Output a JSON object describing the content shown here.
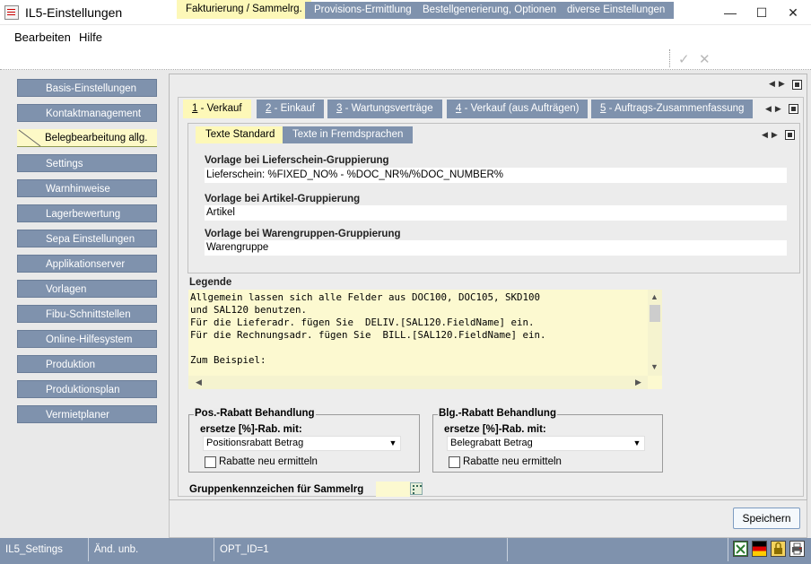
{
  "window": {
    "title": "IL5-Einstellungen",
    "minimize": "—",
    "maximize": "☐",
    "close": "✕"
  },
  "menu": {
    "items": [
      "Bearbeiten",
      "Hilfe"
    ]
  },
  "toolbar": {
    "ok_icon": "✓",
    "cancel_icon": "✕"
  },
  "sidebar": {
    "items": [
      "Basis-Einstellungen",
      "Kontaktmanagement",
      "Belegbearbeitung allg.",
      "Settings",
      "Warnhinweise",
      "Lagerbewertung",
      "Sepa Einstellungen",
      "Applikationserver",
      "Vorlagen",
      "Fibu-Schnittstellen",
      "Online-Hilfesystem",
      "Produktion",
      "Produktionsplan",
      "Vermietplaner"
    ],
    "active_index": 2
  },
  "tabs_main": [
    "Fakturierung / Sammelrg.",
    "Provisions-Ermittlung",
    "Bestellgenerierung, Optionen",
    "diverse Einstellungen"
  ],
  "tabs_sub": [
    {
      "num": "1",
      "label": " - Verkauf"
    },
    {
      "num": "2",
      "label": " - Einkauf"
    },
    {
      "num": "3",
      "label": " - Wartungsverträge"
    },
    {
      "num": "4",
      "label": " - Verkauf (aus Aufträgen)"
    },
    {
      "num": "5",
      "label": " - Auftrags-Zusammenfassung"
    }
  ],
  "tabs_text": [
    "Texte Standard",
    "Texte in Fremdsprachen"
  ],
  "templates": {
    "delivery_label": "Vorlage bei Lieferschein-Gruppierung",
    "delivery_value": "Lieferschein: %FIXED_NO% - %DOC_NR%/%DOC_NUMBER%",
    "article_label": "Vorlage bei Artikel-Gruppierung",
    "article_value": "Artikel",
    "group_label": "Vorlage bei Warengruppen-Gruppierung",
    "group_value": "Warengruppe"
  },
  "legend": {
    "label": "Legende",
    "text": "Allgemein lassen sich alle Felder aus DOC100, DOC105, SKD100\nund SAL120 benutzen.\nFür die Lieferadr. fügen Sie  DELIV.[SAL120.FieldName] ein.\nFür die Rechnungsadr. fügen Sie  BILL.[SAL120.FieldName] ein.\n\nZum Beispiel:"
  },
  "pos_rabatt": {
    "title": "Pos.-Rabatt Behandlung",
    "replace_label": "ersetze [%]-Rab.  mit:",
    "combo_value": "Positionsrabatt Betrag",
    "checkbox_label": "Rabatte neu ermitteln"
  },
  "blg_rabatt": {
    "title": "Blg.-Rabatt Behandlung",
    "replace_label": "ersetze [%]-Rab.  mit:",
    "combo_value": "Belegrabatt Betrag",
    "checkbox_label": "Rabatte neu ermitteln"
  },
  "gruppenkennzeichen": {
    "label": "Gruppenkennzeichen für Sammelrg",
    "value": ""
  },
  "save_label": "Speichern",
  "status": {
    "cell1": "IL5_Settings",
    "cell2": "Änd. unb.",
    "cell3": "OPT_ID=1",
    "cell4": "",
    "icons": [
      "excel-icon",
      "flag-de-icon",
      "lock-icon",
      "printer-icon"
    ],
    "colors": {
      "bar": "#7f92ad",
      "active_tab": "#fdf8b8"
    }
  }
}
